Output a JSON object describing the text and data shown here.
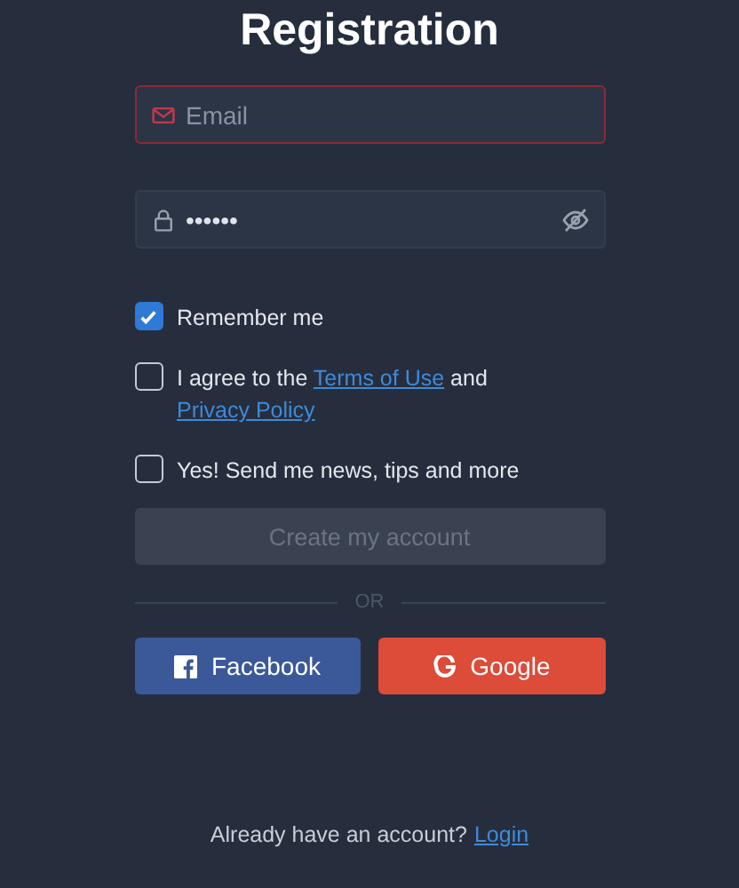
{
  "title": "Registration",
  "email": {
    "placeholder": "Email",
    "error": true
  },
  "password": {
    "value": "••••••"
  },
  "checkboxes": [
    {
      "checked": true,
      "parts": [
        {
          "kind": "text",
          "text": "Remember me"
        }
      ]
    },
    {
      "checked": false,
      "parts": [
        {
          "kind": "text",
          "text": "I agree to the "
        },
        {
          "kind": "link",
          "text": "Terms of Use"
        },
        {
          "kind": "text",
          "text": " and "
        },
        {
          "kind": "link",
          "text": "Privacy Policy"
        }
      ]
    },
    {
      "checked": false,
      "parts": [
        {
          "kind": "text",
          "text": "Yes! Send me news, tips and more"
        }
      ]
    }
  ],
  "submit": {
    "label": "Create my account",
    "disabled": true
  },
  "divider": "OR",
  "social": [
    {
      "kind": "facebook",
      "label": "Facebook",
      "color": "#3b5998"
    },
    {
      "kind": "google",
      "label": "Google",
      "color": "#dd4b39"
    }
  ],
  "footer": {
    "text": "Already have an account?",
    "link": "Login"
  }
}
